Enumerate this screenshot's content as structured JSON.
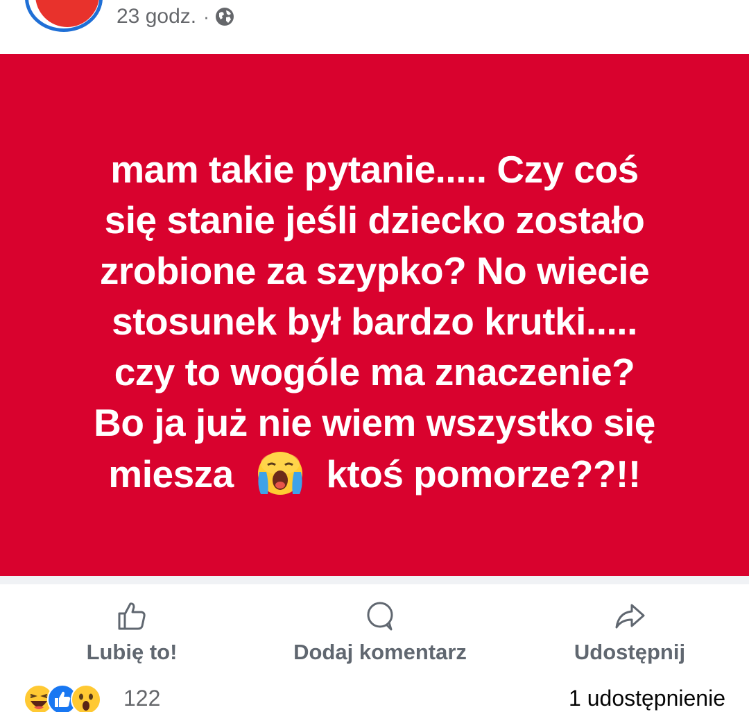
{
  "header": {
    "time": "23 godz.",
    "separator": "·",
    "audience_icon": "globe-icon"
  },
  "post": {
    "background_color": "#d9022e",
    "text_color": "#ffffff",
    "lines": [
      "mam takie pytanie..... Czy coś",
      "się stanie jeśli dziecko zostało",
      "zrobione za szypko? No wiecie",
      "stosunek był bardzo krutki.....",
      "czy to wogóle ma znaczenie?",
      "Bo ja już nie wiem wszystko się"
    ],
    "last_line_before": "miesza",
    "last_line_emoji": "crying-face-icon",
    "last_line_after": "ktoś pomorze??!!"
  },
  "actions": {
    "like": {
      "label": "Lubię to!",
      "icon": "thumbs-up-icon"
    },
    "comment": {
      "label": "Dodaj komentarz",
      "icon": "comment-bubble-icon"
    },
    "share": {
      "label": "Udostępnij",
      "icon": "share-arrow-icon"
    }
  },
  "footer": {
    "reaction_icons": [
      "haha-icon",
      "like-icon",
      "wow-icon"
    ],
    "reaction_count": "122",
    "shares_text": "1 udostępnienie"
  }
}
